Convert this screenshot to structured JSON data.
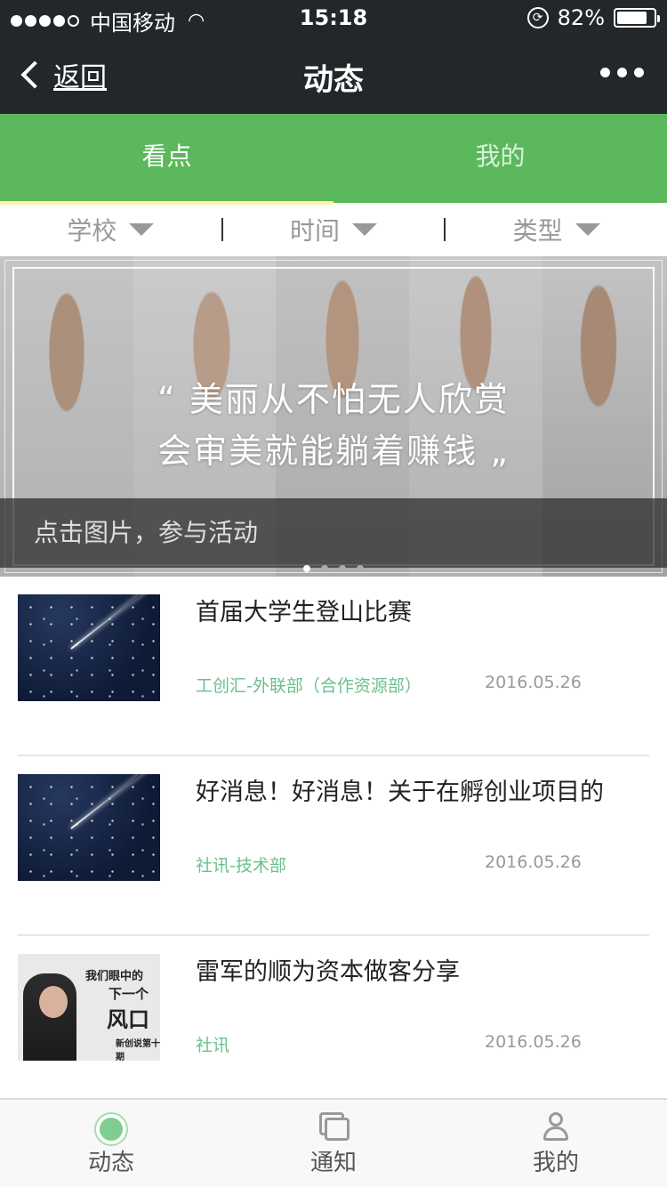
{
  "status_bar": {
    "carrier": "中国移动",
    "time": "15:18",
    "battery": "82%",
    "battery_level": 0.82
  },
  "nav": {
    "back_label": "返回",
    "title": "动态"
  },
  "tabs": [
    {
      "label": "看点",
      "active": true
    },
    {
      "label": "我的",
      "active": false
    }
  ],
  "filters": [
    {
      "label": "学校"
    },
    {
      "label": "时间"
    },
    {
      "label": "类型"
    }
  ],
  "banner": {
    "quote_line1": "“ 美丽从不怕无人欣赏",
    "quote_line2": "会审美就能躺着赚钱 „",
    "caption": "点击图片，参与活动",
    "page_count": 4,
    "current_page": 1
  },
  "articles": [
    {
      "title": "首届大学生登山比赛",
      "source": "工创汇-外联部（合作资源部）",
      "date": "2016.05.26",
      "thumb": "space"
    },
    {
      "title": "好消息！好消息！关于在孵创业项目的",
      "source": "社讯-技术部",
      "date": "2016.05.26",
      "thumb": "space"
    },
    {
      "title": "雷军的顺为资本做客分享",
      "source": "社讯",
      "date": "2016.05.26",
      "thumb": "promo",
      "thumb_text": [
        "我们眼中的",
        "下一个",
        "风口",
        "新创说第十期"
      ]
    }
  ],
  "tabbar": [
    {
      "label": "动态",
      "icon": "sun-icon",
      "active": true
    },
    {
      "label": "通知",
      "icon": "chat-icon",
      "active": false
    },
    {
      "label": "我的",
      "icon": "user-icon",
      "active": false
    }
  ]
}
